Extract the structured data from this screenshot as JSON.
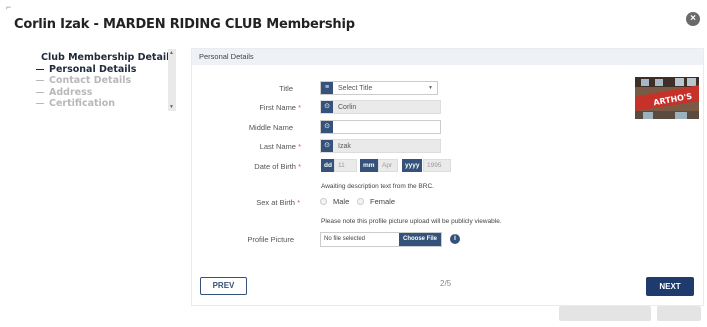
{
  "window": {
    "title": "Corlin Izak - MARDEN RIDING CLUB Membership",
    "close_label": "×"
  },
  "steps": [
    {
      "label": "Club Membership Details",
      "state": "done"
    },
    {
      "label": "Personal Details",
      "state": "current"
    },
    {
      "label": "Contact Details",
      "state": "todo"
    },
    {
      "label": "Address",
      "state": "todo"
    },
    {
      "label": "Certification",
      "state": "todo"
    }
  ],
  "panel": {
    "header": "Personal Details"
  },
  "form": {
    "title": {
      "label": "Title",
      "value": "Select Title",
      "icon": "list-icon"
    },
    "first_name": {
      "label": "First Name",
      "required_mark": "*",
      "value": "Corlin",
      "icon": "lock-icon"
    },
    "middle_name": {
      "label": "Middle Name",
      "value": "",
      "icon": "lock-icon"
    },
    "last_name": {
      "label": "Last Name",
      "required_mark": "*",
      "value": "Izak",
      "icon": "lock-icon"
    },
    "dob": {
      "label": "Date of Birth",
      "required_mark": "*",
      "day_tag": "dd",
      "day_value": "11",
      "month_tag": "mm",
      "month_value": "Apr",
      "year_tag": "yyyy",
      "year_value": "1995"
    },
    "dob_note": "Awaiting description text from the BRC.",
    "sex": {
      "label": "Sex at Birth",
      "required_mark": "*",
      "options": [
        "Male",
        "Female"
      ]
    },
    "picture_note": "Please note this profile picture upload will be publicly viewable.",
    "profile_picture": {
      "label": "Profile Picture",
      "file_text": "No file selected",
      "button": "Choose File",
      "info": "i"
    }
  },
  "nav": {
    "prev": "PREV",
    "page_indicator": "2/5",
    "next": "NEXT"
  },
  "photo": {
    "sign_text": "ARTHO'S"
  },
  "colors": {
    "accent": "#34527a",
    "primary": "#1f3b6e",
    "required": "#d9534f"
  }
}
